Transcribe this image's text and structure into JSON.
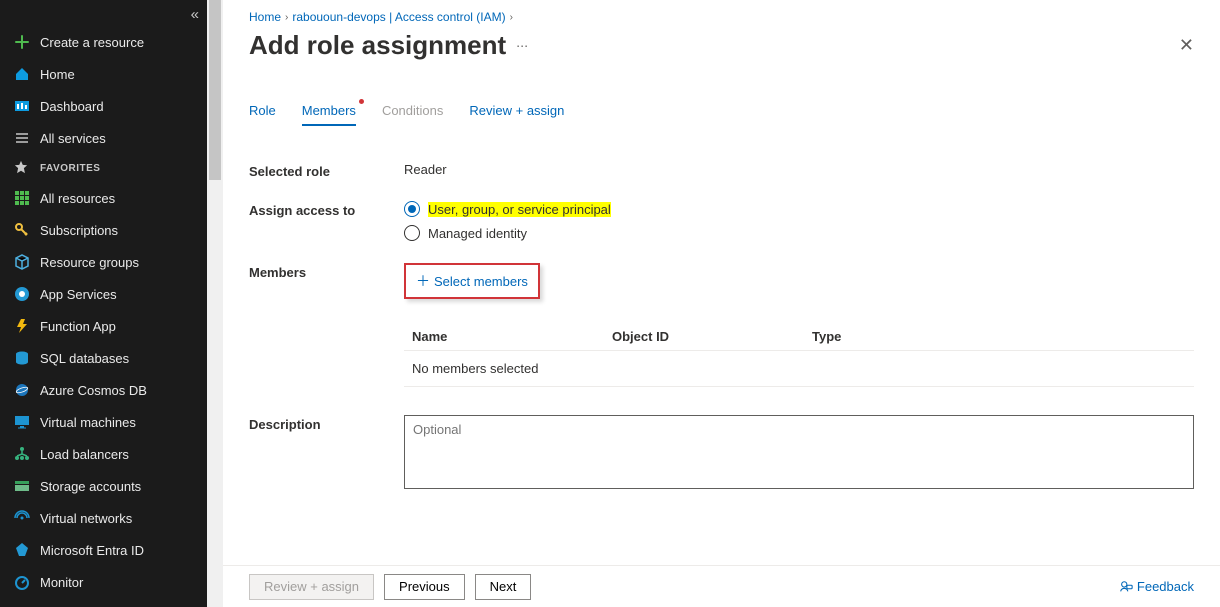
{
  "sidebar": {
    "create": "Create a resource",
    "home": "Home",
    "dashboard": "Dashboard",
    "all_services": "All services",
    "favorites_header": "FAVORITES",
    "favorites": [
      "All resources",
      "Subscriptions",
      "Resource groups",
      "App Services",
      "Function App",
      "SQL databases",
      "Azure Cosmos DB",
      "Virtual machines",
      "Load balancers",
      "Storage accounts",
      "Virtual networks",
      "Microsoft Entra ID",
      "Monitor"
    ]
  },
  "breadcrumb": {
    "home": "Home",
    "item1": "rabououn-devops | Access control (IAM)"
  },
  "page": {
    "title": "Add role assignment"
  },
  "tabs": {
    "role": "Role",
    "members": "Members",
    "conditions": "Conditions",
    "review": "Review + assign"
  },
  "form": {
    "selected_role_label": "Selected role",
    "selected_role_value": "Reader",
    "assign_access_label": "Assign access to",
    "radio_user": "User, group, or service principal",
    "radio_managed": "Managed identity",
    "members_label": "Members",
    "select_members": "Select members",
    "table": {
      "name": "Name",
      "object_id": "Object ID",
      "type": "Type",
      "empty": "No members selected"
    },
    "description_label": "Description",
    "description_placeholder": "Optional"
  },
  "footer": {
    "review": "Review + assign",
    "previous": "Previous",
    "next": "Next",
    "feedback": "Feedback"
  }
}
